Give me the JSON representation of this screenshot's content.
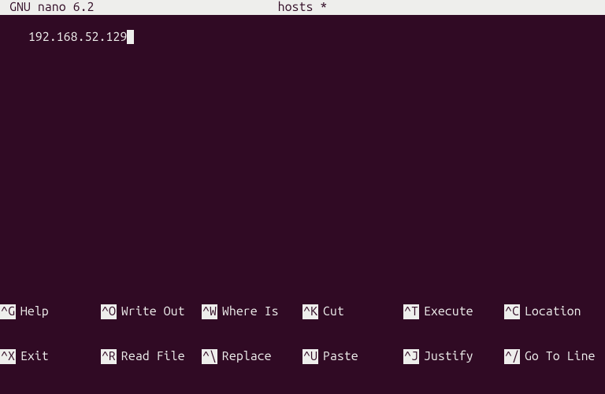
{
  "titlebar": {
    "editor_name": "GNU nano 6.2",
    "filename": "hosts *"
  },
  "editor": {
    "content_line_0": "192.168.52.129"
  },
  "help": {
    "row0": [
      {
        "key": "^G",
        "label": "Help"
      },
      {
        "key": "^O",
        "label": "Write Out"
      },
      {
        "key": "^W",
        "label": "Where Is"
      },
      {
        "key": "^K",
        "label": "Cut"
      },
      {
        "key": "^T",
        "label": "Execute"
      },
      {
        "key": "^C",
        "label": "Location"
      }
    ],
    "row1": [
      {
        "key": "^X",
        "label": "Exit"
      },
      {
        "key": "^R",
        "label": "Read File"
      },
      {
        "key": "^\\",
        "label": "Replace"
      },
      {
        "key": "^U",
        "label": "Paste"
      },
      {
        "key": "^J",
        "label": "Justify"
      },
      {
        "key": "^/",
        "label": "Go To Line"
      }
    ]
  }
}
